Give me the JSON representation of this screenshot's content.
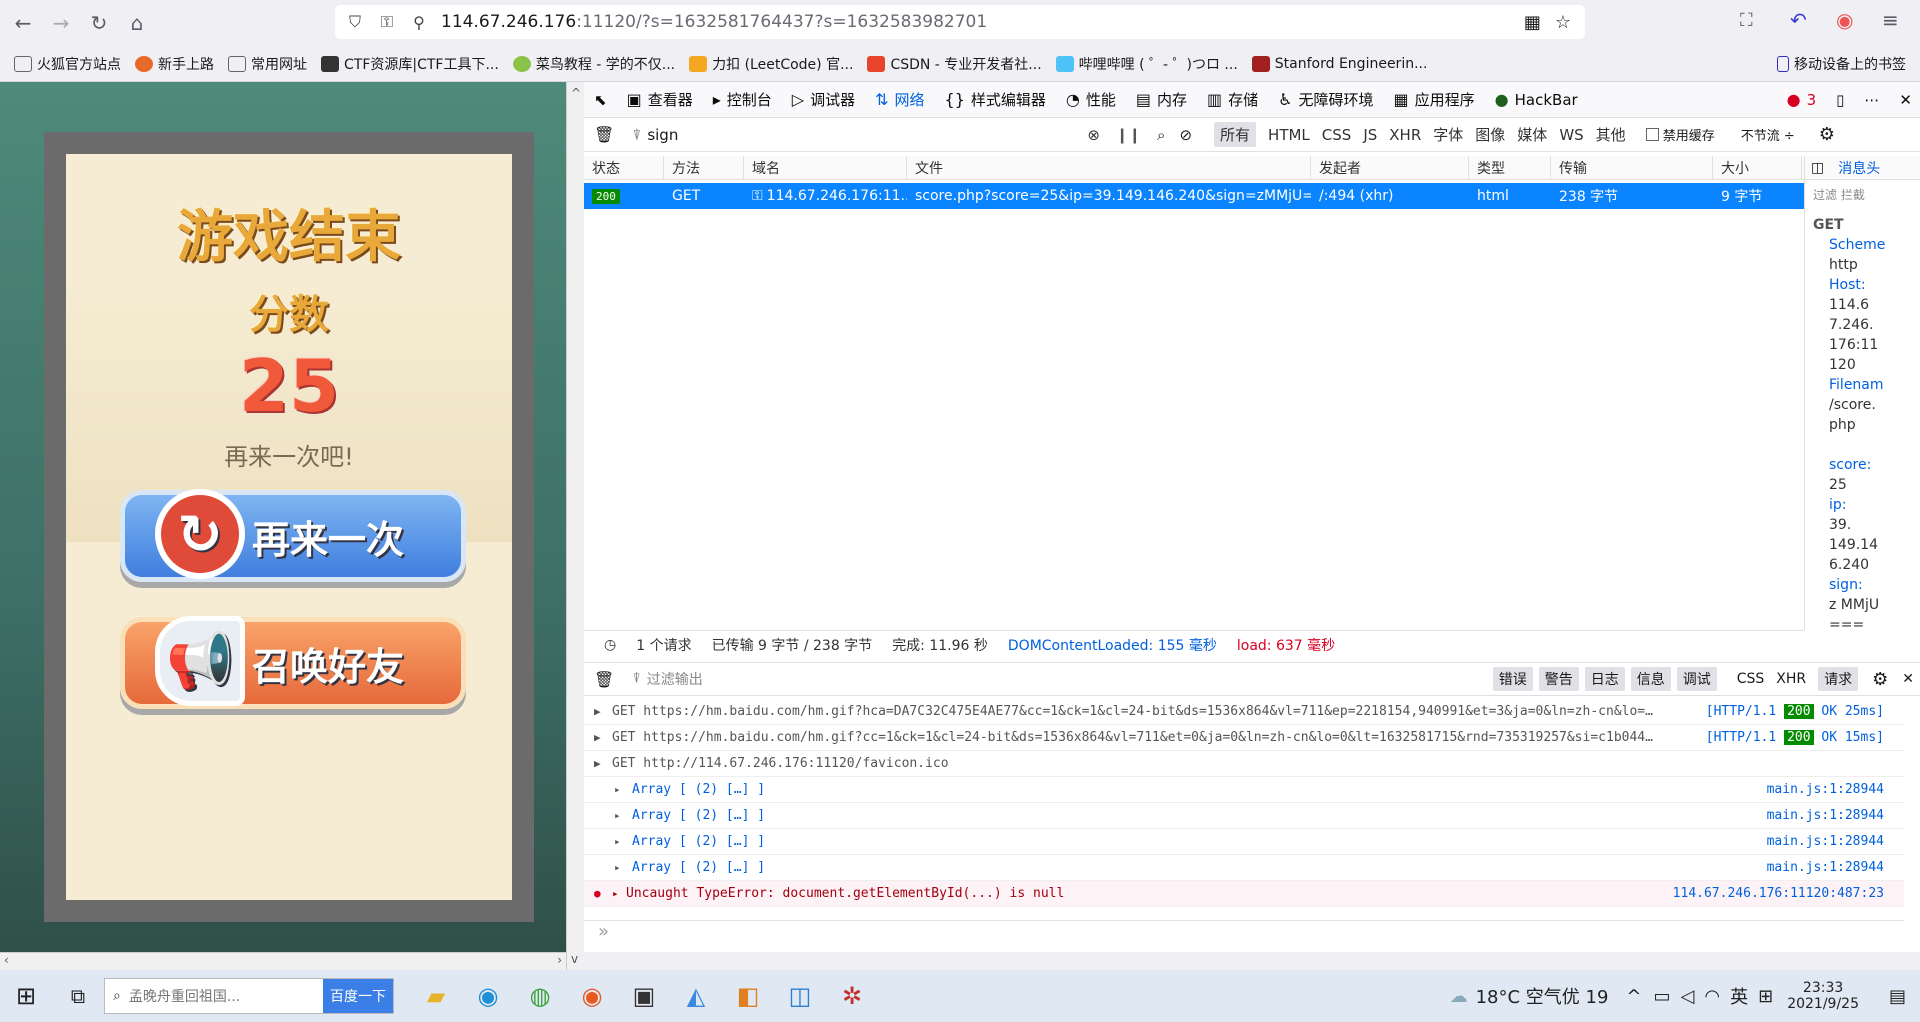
{
  "browser": {
    "url_host": "114.67.246.176",
    "url_rest": ":11120/?s=1632581764437?s=1632583982701",
    "bookmarks": [
      "火狐官方站点",
      "新手上路",
      "常用网址",
      "CTF资源库|CTF工具下...",
      "菜鸟教程 - 学的不仅...",
      "力扣 (LeetCode) 官...",
      "CSDN - 专业开发者社...",
      "哔哩哔哩 ( ゜- ゜)つロ ...",
      "Stanford Engineerin..."
    ],
    "mobile_bookmarks": "移动设备上的书签"
  },
  "game": {
    "title": "游戏结束",
    "score_label": "分数",
    "score": "25",
    "again_text": "再来一次吧!",
    "retry_button": "再来一次",
    "invite_button": "召唤好友"
  },
  "devtools": {
    "tabs": [
      "查看器",
      "控制台",
      "调试器",
      "网络",
      "样式编辑器",
      "性能",
      "内存",
      "存储",
      "无障碍环境",
      "应用程序",
      "HackBar"
    ],
    "error_count": "3",
    "filter_text": "sign",
    "type_filters": [
      "所有",
      "HTML",
      "CSS",
      "JS",
      "XHR",
      "字体",
      "图像",
      "媒体",
      "WS",
      "其他"
    ],
    "disable_cache": "禁用缓存",
    "throttle": "不节流 ÷",
    "columns": [
      "状态",
      "方法",
      "域名",
      "文件",
      "发起者",
      "类型",
      "传输",
      "大小"
    ],
    "request": {
      "status": "200",
      "method": "GET",
      "domain": "114.67.246.176:11...",
      "file": "score.php?score=25&ip=39.149.146.240&sign=zMMjU===",
      "initiator": "/:494 (xhr)",
      "type": "html",
      "transferred": "238 字节",
      "size": "9 字节"
    },
    "summary": {
      "requests": "1 个请求",
      "transferred": "已传输 9 字节 / 238 字节",
      "finish": "完成: 11.96 秒",
      "dcl": "DOMContentLoaded: 155 毫秒",
      "load": "load: 637 毫秒"
    },
    "side": {
      "tab": "消息头",
      "filter": "过滤 拦截",
      "method": "GET",
      "scheme_k": "Scheme",
      "scheme_v": "http",
      "host_k": "Host:",
      "host_v": "114.6 7.246. 176:11 120",
      "file_k": "Filenam",
      "file_v": "/score. php",
      "score_k": "score:",
      "score_v": "25",
      "ip_k": "ip:",
      "ip_v": "39. 149.14 6.240",
      "sign_k": "sign:",
      "sign_v": "z MMjU ==="
    },
    "console": {
      "filter_placeholder": "过滤输出",
      "levels": [
        "错误",
        "警告",
        "日志",
        "信息",
        "调试"
      ],
      "kinds": [
        "CSS",
        "XHR",
        "请求"
      ],
      "logs": [
        {
          "text": "GET https://hm.baidu.com/hm.gif?hca=DA7C32C475E4AE77&cc=1&ck=1&cl=24-bit&ds=1536x864&vl=711&ep=2218154,940991&et=3&ja=0&ln=zh-cn&lo=…",
          "proto": "[HTTP/1.1",
          "code": "200",
          "ok": "OK 25ms]"
        },
        {
          "text": "GET https://hm.baidu.com/hm.gif?cc=1&ck=1&cl=24-bit&ds=1536x864&vl=711&et=0&ja=0&ln=zh-cn&lo=0&lt=1632581715&rnd=735319257&si=c1b044…",
          "proto": "[HTTP/1.1",
          "code": "200",
          "ok": "OK 15ms]"
        },
        {
          "text": "GET http://114.67.246.176:11120/favicon.ico",
          "proto": "",
          "code": "",
          "ok": ""
        }
      ],
      "arrays": [
        "Array [ (2) […] ]",
        "Array [ (2) […] ]",
        "Array [ (2) […] ]",
        "Array [ (2) […] ]"
      ],
      "array_src": "main.js:1:28944",
      "error": "Uncaught TypeError: document.getElementById(...) is null",
      "error_src": "114.67.246.176:11120:487:23"
    }
  },
  "taskbar": {
    "search_placeholder": "孟晚舟重回祖国...",
    "search_button": "百度一下",
    "weather": "18°C 空气优 19",
    "ime": "英",
    "time": "23:33",
    "date": "2021/9/25"
  }
}
